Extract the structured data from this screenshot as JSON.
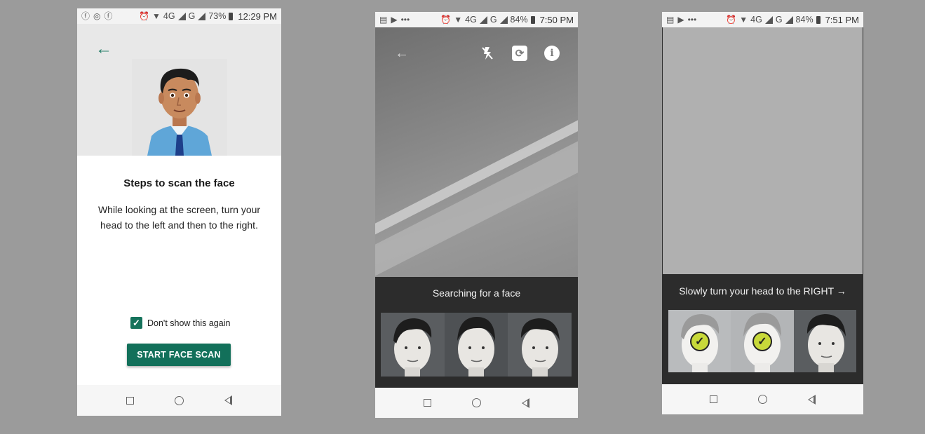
{
  "phone1": {
    "status": {
      "battery": "73%",
      "time": "12:29 PM",
      "net1": "4G",
      "net2": "G"
    },
    "title": "Steps to scan the face",
    "description": "While looking at the screen, turn your head to the left and then to the right.",
    "checkbox_label": "Don't show this again",
    "checkbox_checked": true,
    "button_label": "START FACE SCAN"
  },
  "phone2": {
    "status": {
      "battery": "84%",
      "time": "7:50 PM",
      "net1": "4G",
      "net2": "G",
      "more": "•••"
    },
    "status_text": "Searching for a face"
  },
  "phone3": {
    "status": {
      "battery": "84%",
      "time": "7:51 PM",
      "net1": "4G",
      "net2": "G",
      "more": "•••"
    },
    "instruction": "Slowly turn your head to the RIGHT →"
  },
  "colors": {
    "accent": "#12705a",
    "check_badge": "#c8d93a",
    "panel": "#2c2c2c"
  },
  "icons": [
    "back-arrow-icon",
    "flash-off-icon",
    "camera-flip-icon",
    "info-icon",
    "checkmark-icon"
  ]
}
